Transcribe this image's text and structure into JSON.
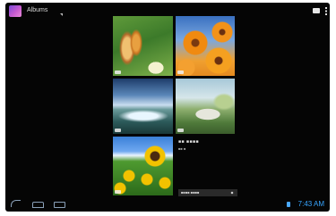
{
  "action_bar": {
    "title": "Albums",
    "camera_icon": "camera-icon",
    "overflow_icon": "overflow-menu-icon"
  },
  "album": {
    "title": "■■ ■■■■",
    "count": "■■ ■",
    "share_label": "■■■■ ■■■■"
  },
  "system_bar": {
    "clock": "7:43 AM",
    "back_icon": "back-icon",
    "home_icon": "home-icon",
    "recent_icon": "recent-apps-icon"
  },
  "colors": {
    "background": "#050505",
    "accent": "#37a5ff"
  }
}
